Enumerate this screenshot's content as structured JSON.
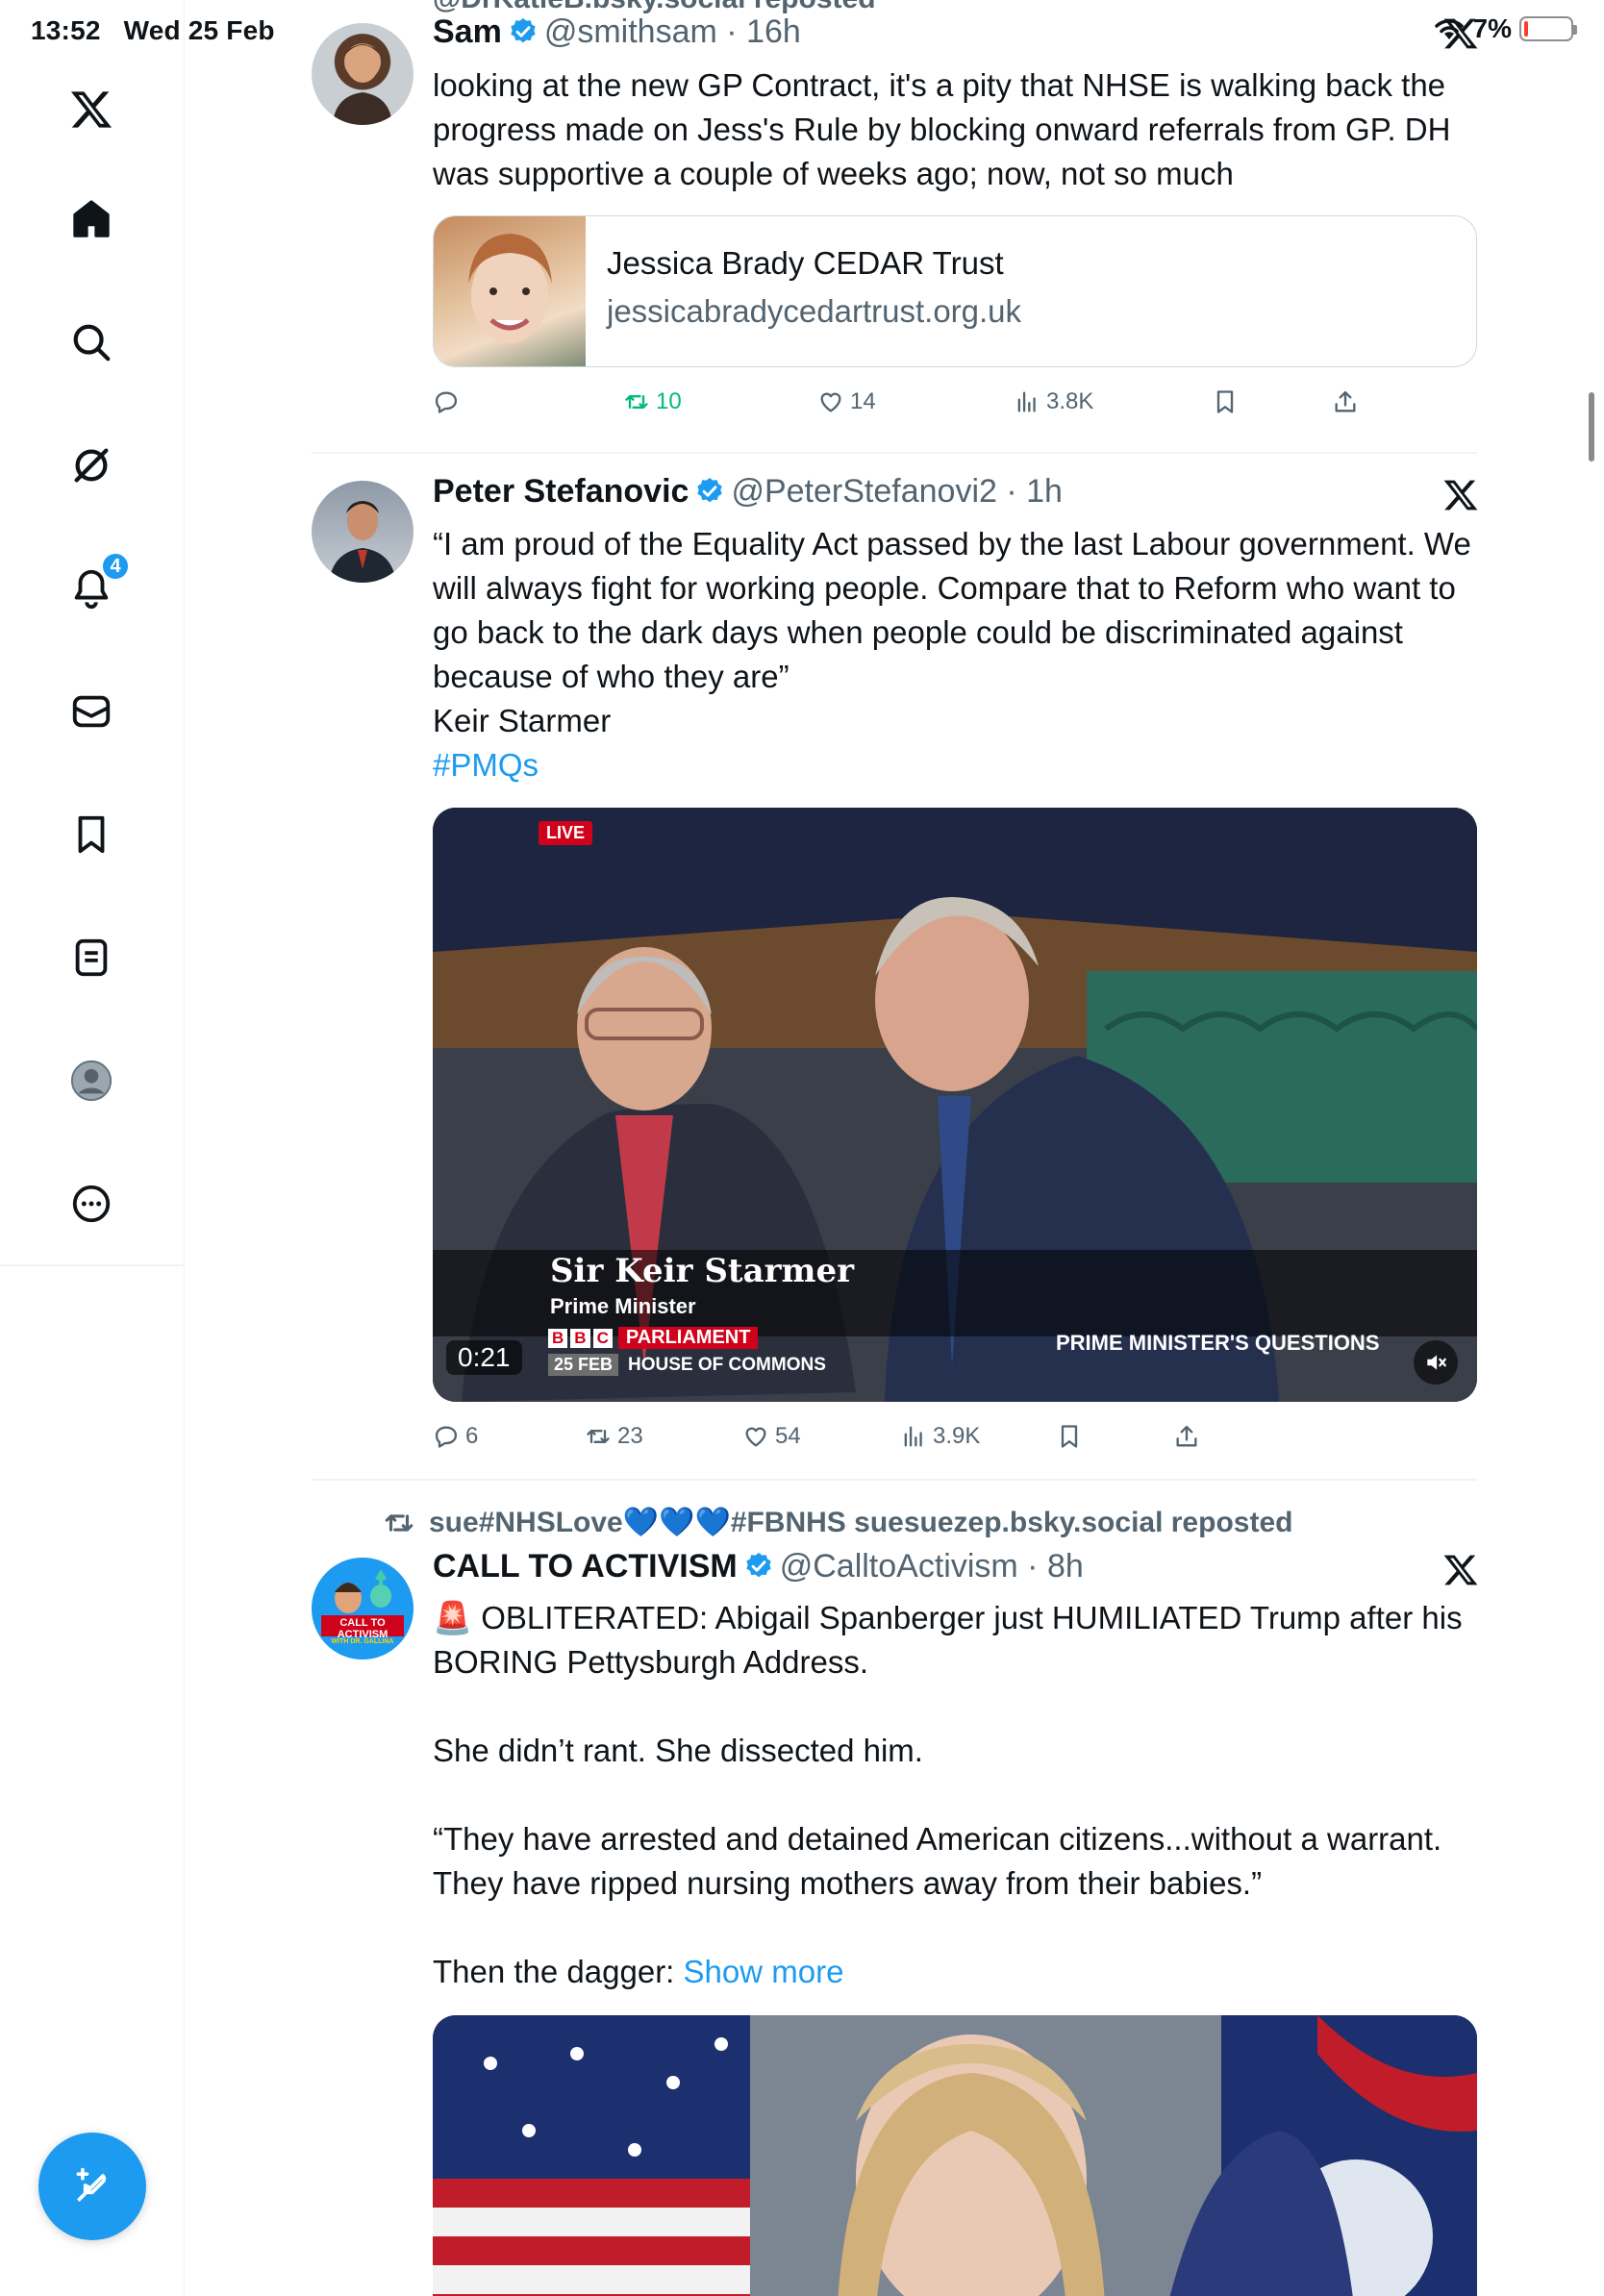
{
  "status_bar": {
    "time": "13:52",
    "date": "Wed 25 Feb",
    "battery": "7%",
    "battery_level": 0.07
  },
  "sidebar": {
    "notifications_badge": "4",
    "items": [
      "x-logo",
      "home",
      "explore",
      "grok",
      "notifications",
      "messages",
      "bookmarks",
      "lists",
      "profile",
      "more"
    ]
  },
  "top_partial": "@DrKatieB.bsky.social reposted",
  "tweets": [
    {
      "name": "Sam",
      "handle": "@smithsam",
      "time": "16h",
      "text": "looking at the new GP Contract, it's a pity that NHSE is walking back the progress made on Jess's Rule by blocking onward referrals from GP. DH was supportive a couple of weeks ago; now, not so much",
      "card": {
        "title": "Jessica Brady CEDAR Trust",
        "domain": "jessicabradycedartrust.org.uk"
      },
      "stats": {
        "replies": "",
        "reposts": "10",
        "likes": "14",
        "views": "3.8K"
      }
    },
    {
      "name": "Peter Stefanovic",
      "handle": "@PeterStefanovi2",
      "time": "1h",
      "text_lines": [
        "“I am proud of the Equality Act passed by the last Labour government. We will always fight for working people. Compare that to Reform who want to go back to the dark days when people could be discriminated against because of who they are”",
        "Keir Starmer"
      ],
      "hashtag": "#PMQs",
      "video": {
        "live_label": "LIVE",
        "caption_name": "Sir Keir Starmer",
        "caption_role": "Prime Minister",
        "channel": "PARLIAMENT",
        "bbc": [
          "B",
          "B",
          "C"
        ],
        "date": "25 FEB",
        "location": "HOUSE OF COMMONS",
        "programme": "PRIME MINISTER'S QUESTIONS",
        "duration": "0:21"
      },
      "stats": {
        "replies": "6",
        "reposts": "23",
        "likes": "54",
        "views": "3.9K"
      }
    },
    {
      "repost_by": "sue#NHSLove💙💙💙#FBNHS suesuezep.bsky.social reposted",
      "name": "CALL TO ACTIVISM",
      "handle": "@CalltoActivism",
      "time": "8h",
      "avatar_text": "CALL TO ACTIVISM",
      "avatar_subtext": "WITH DR. GALLINA",
      "paragraphs": [
        "🚨 OBLITERATED: Abigail Spanberger just HUMILIATED Trump after his BORING Pettysburgh Address.",
        "She didn’t rant. She dissected him.",
        "“They have arrested and detained American citizens...without a warrant. They have ripped nursing mothers away from their babies.”"
      ],
      "last_line": "Then the dagger:",
      "show_more": "Show more"
    }
  ]
}
